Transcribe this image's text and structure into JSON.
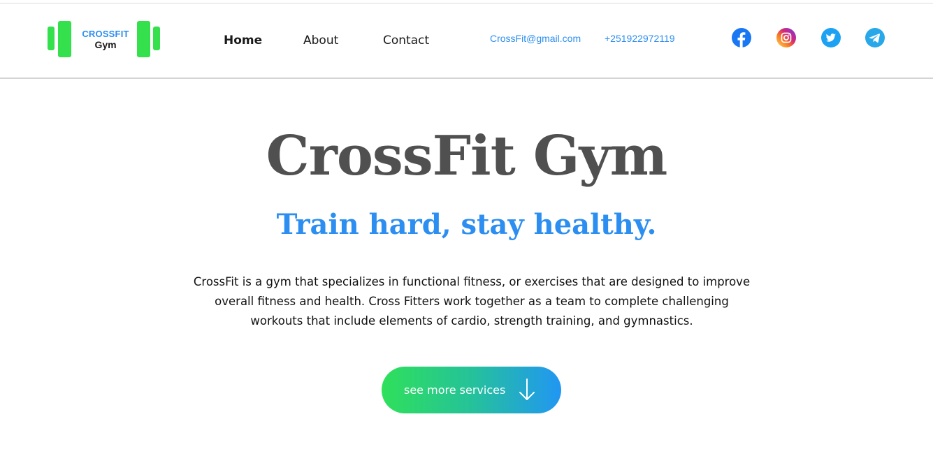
{
  "brand": {
    "line1": "CROSSFIT",
    "line2": "Gym",
    "accent": "#35e04d",
    "blue": "#2b8ef0"
  },
  "nav": {
    "items": [
      {
        "label": "Home",
        "active": true
      },
      {
        "label": "About",
        "active": false
      },
      {
        "label": "Contact",
        "active": false
      }
    ]
  },
  "contact": {
    "email": "CrossFit@gmail.com",
    "phone": "+251922972119"
  },
  "social": [
    "facebook-icon",
    "instagram-icon",
    "twitter-icon",
    "telegram-icon"
  ],
  "hero": {
    "title": "CrossFit Gym",
    "subtitle": "Train hard, stay healthy.",
    "description": "CrossFit is a gym that specializes in functional fitness, or exercises that are designed to improve overall fitness and health. Cross Fitters work together as a team to complete challenging workouts that include elements of cardio, strength training, and gymnastics.",
    "cta_label": "see more services"
  }
}
